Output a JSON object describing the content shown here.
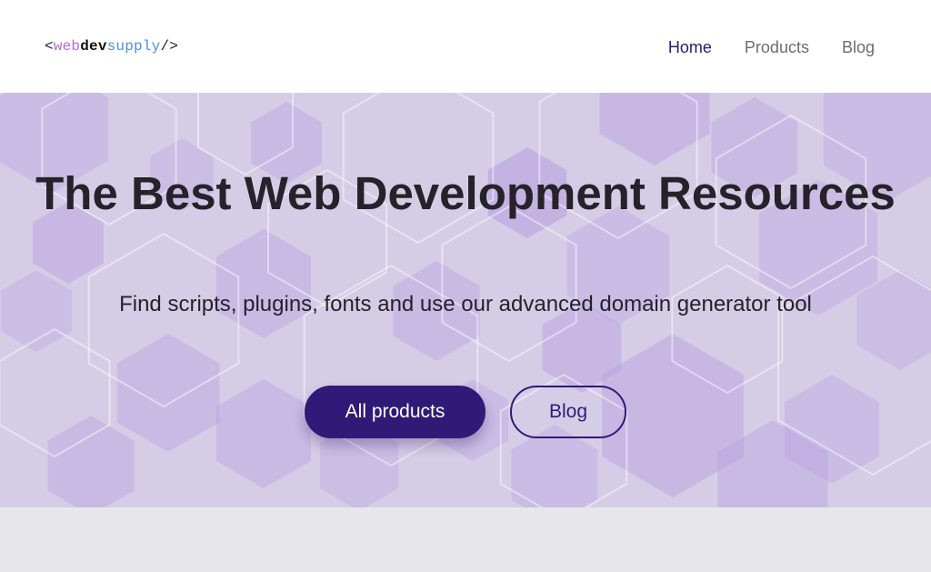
{
  "logo": {
    "open": "<",
    "web": "web",
    "dev": "dev",
    "supply": "supply",
    "close": "/>"
  },
  "nav": {
    "home": "Home",
    "products": "Products",
    "blog": "Blog"
  },
  "hero": {
    "title": "The Best Web Development Resources",
    "subtitle": "Find scripts, plugins, fonts and use our advanced domain generator tool",
    "primary_button": "All products",
    "secondary_button": "Blog"
  },
  "colors": {
    "accent": "#2f1b77",
    "hero_bg": "#d5cde6",
    "hexagon": "#b79de0"
  }
}
